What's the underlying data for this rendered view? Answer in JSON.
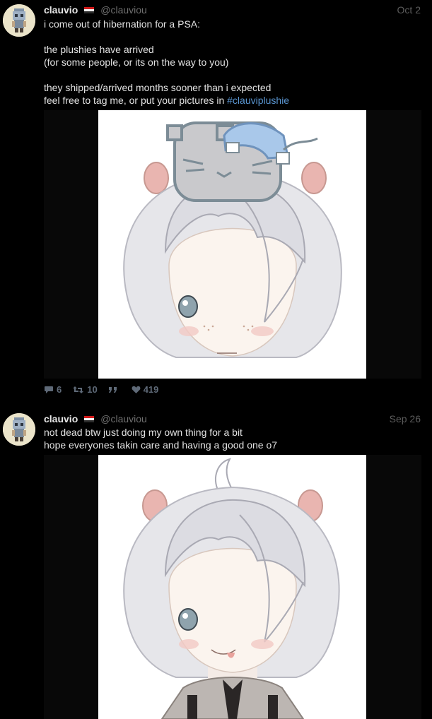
{
  "tweets": [
    {
      "author_name": "clauvio",
      "handle": "@clauviou",
      "date": "Oct 2",
      "lines": [
        "i come out of hibernation for a PSA:",
        "",
        "the plushies have arrived",
        "(for some people, or its on the way to you)",
        "",
        "they shipped/arrived months sooner than i expected"
      ],
      "last_line_prefix": "feel free to tag me, or put your pictures in ",
      "hashtag": "#clauviplushie",
      "replies": "6",
      "retweets": "10",
      "likes": "419"
    },
    {
      "author_name": "clauvio",
      "handle": "@clauviou",
      "date": "Sep 26",
      "lines": [
        "not dead btw just doing my own thing for a bit",
        "hope everyones takin care and having a good one o7"
      ]
    }
  ],
  "colors": {
    "background": "#000000",
    "hashtag": "#5a95d0",
    "muted": "#6f6f6f",
    "action": "#5f6a78",
    "flag_top": "#d11a1a",
    "flag_bottom": "#2a2a2a"
  },
  "icons": [
    "reply-icon",
    "retweet-icon",
    "quote-icon",
    "heart-icon",
    "flag-icon"
  ]
}
